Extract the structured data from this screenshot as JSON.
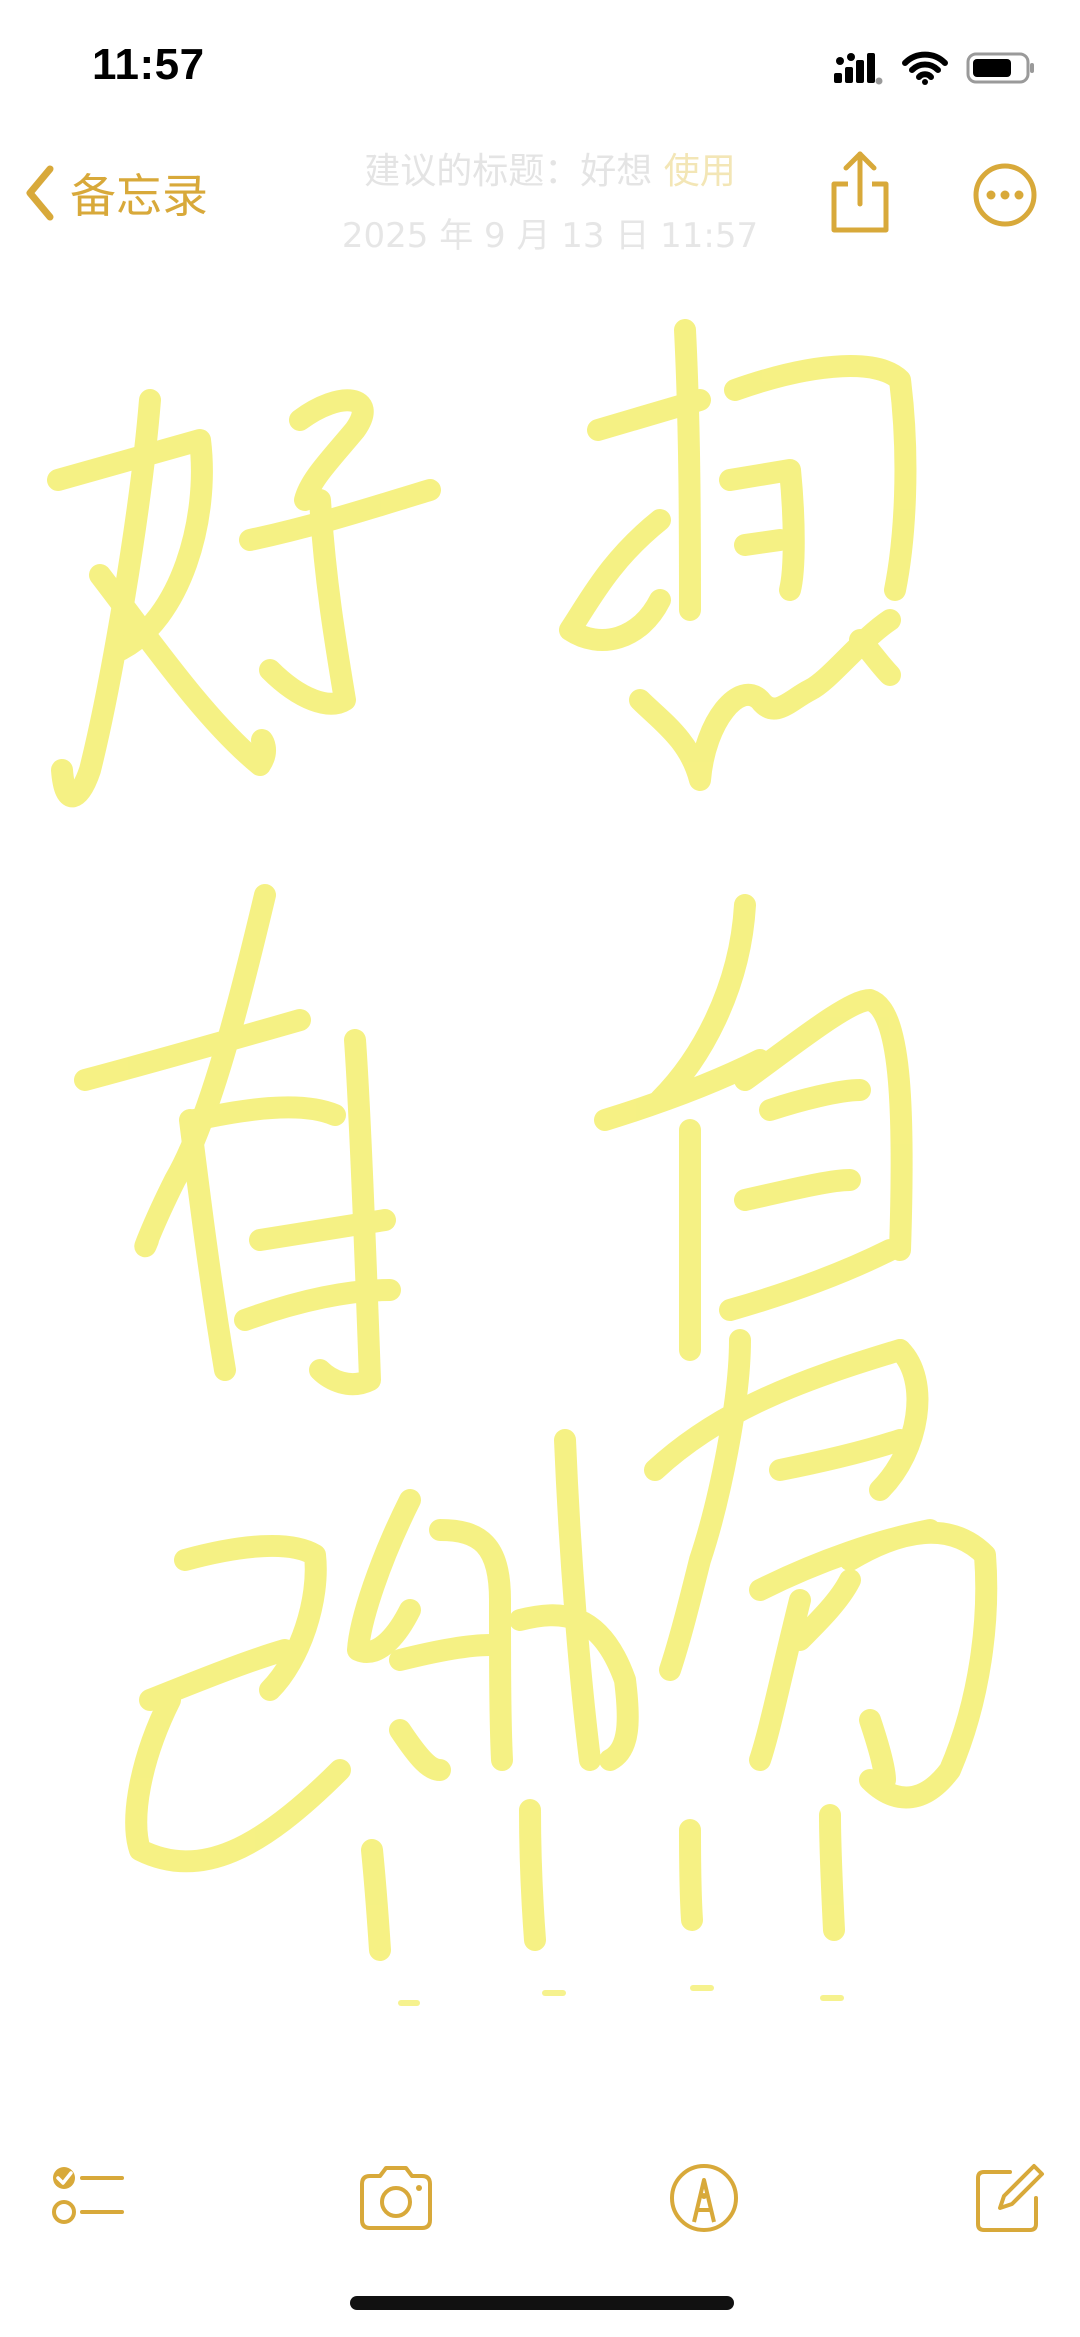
{
  "status_bar": {
    "time": "11:57"
  },
  "nav": {
    "back_label": "备忘录",
    "title_prefix": "建议的标题：",
    "title_main": "好想",
    "title_suggestion": "使用",
    "subtitle": "2025 年 9 月 13 日 11:57"
  },
  "icons": {
    "back": "chevron-left-icon",
    "share": "share-icon",
    "more": "ellipsis-circle-icon",
    "checklist": "checklist-icon",
    "camera": "camera-icon",
    "markup": "pen-tip-icon",
    "compose": "compose-icon"
  },
  "colors": {
    "accent": "#D8A93A",
    "ink": "#F5F07A"
  }
}
